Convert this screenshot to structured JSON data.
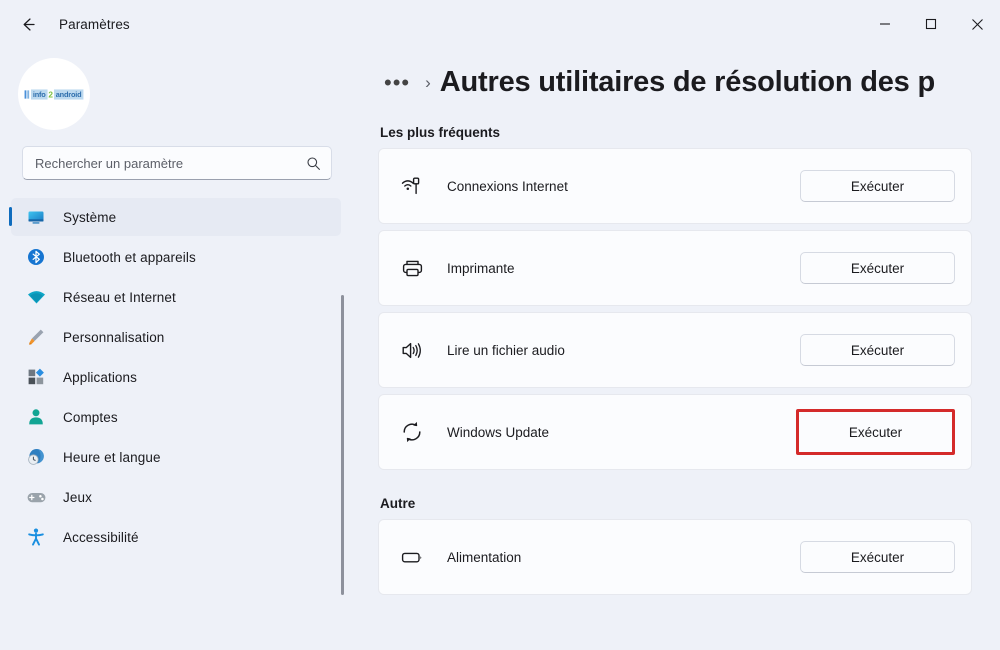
{
  "window": {
    "app_title": "Paramètres",
    "back_icon": "back-arrow-icon",
    "minimize_label": "Réduire",
    "maximize_label": "Agrandir",
    "close_label": "Fermer"
  },
  "sidebar": {
    "avatar": {
      "watermark_text": "info24android",
      "watermark_parts": {
        "prefix": "info",
        "droid": "2",
        "suffix": "android"
      }
    },
    "search": {
      "placeholder": "Rechercher un paramètre",
      "value": "",
      "icon": "search-icon"
    },
    "items": [
      {
        "label": "Système",
        "icon": "system-monitor-icon",
        "selected": true
      },
      {
        "label": "Bluetooth et appareils",
        "icon": "bluetooth-icon",
        "selected": false
      },
      {
        "label": "Réseau et Internet",
        "icon": "wifi-icon",
        "selected": false
      },
      {
        "label": "Personnalisation",
        "icon": "paintbrush-icon",
        "selected": false
      },
      {
        "label": "Applications",
        "icon": "apps-blocks-icon",
        "selected": false
      },
      {
        "label": "Comptes",
        "icon": "person-icon",
        "selected": false
      },
      {
        "label": "Heure et langue",
        "icon": "clock-globe-icon",
        "selected": false
      },
      {
        "label": "Jeux",
        "icon": "gamepad-icon",
        "selected": false
      },
      {
        "label": "Accessibilité",
        "icon": "accessibility-person-icon",
        "selected": false
      }
    ],
    "scrollbar": "sidebar-scrollbar"
  },
  "main": {
    "breadcrumb": {
      "overflow_label": "•••",
      "separator": "›",
      "title": "Autres utilitaires de résolution des p"
    },
    "sections": [
      {
        "heading": "Les plus fréquents",
        "rows": [
          {
            "label": "Connexions Internet",
            "icon": "internet-connection-icon",
            "button": "Exécuter",
            "highlighted": false
          },
          {
            "label": "Imprimante",
            "icon": "printer-icon",
            "button": "Exécuter",
            "highlighted": false
          },
          {
            "label": "Lire un fichier audio",
            "icon": "speaker-audio-icon",
            "button": "Exécuter",
            "highlighted": false
          },
          {
            "label": "Windows Update",
            "icon": "refresh-sync-icon",
            "button": "Exécuter",
            "highlighted": true
          }
        ]
      },
      {
        "heading": "Autre",
        "rows": [
          {
            "label": "Alimentation",
            "icon": "battery-icon",
            "button": "Exécuter",
            "highlighted": false
          }
        ]
      }
    ]
  },
  "colors": {
    "window_bg": "#eef1f8",
    "card_bg": "#fbfcfe",
    "accent": "#0f6cbd",
    "highlight_red": "#d42a2a",
    "text": "#1b1b1f"
  }
}
